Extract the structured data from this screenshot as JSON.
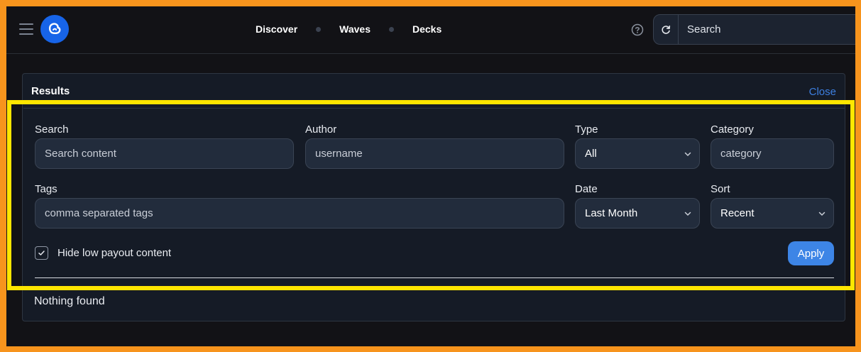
{
  "header": {
    "nav": [
      "Discover",
      "Waves",
      "Decks"
    ],
    "search_placeholder": "Search"
  },
  "icons": {
    "menu": "hamburger-menu-icon",
    "logo": "ecency-logo-icon",
    "help": "help-circle-icon",
    "refresh": "refresh-icon",
    "chevron": "chevron-down-icon",
    "check": "check-icon"
  },
  "colors": {
    "accent": "#3d85e6",
    "logo": "#1764e8",
    "highlight": "#ffe600",
    "frame": "#f7941d"
  },
  "panel": {
    "title": "Results",
    "close_label": "Close",
    "filters": {
      "search": {
        "label": "Search",
        "placeholder": "Search content"
      },
      "author": {
        "label": "Author",
        "placeholder": "username"
      },
      "type": {
        "label": "Type",
        "value": "All"
      },
      "category": {
        "label": "Category",
        "placeholder": "category"
      },
      "tags": {
        "label": "Tags",
        "placeholder": "comma separated tags"
      },
      "date": {
        "label": "Date",
        "value": "Last Month"
      },
      "sort": {
        "label": "Sort",
        "value": "Recent"
      },
      "hide_low_payout": {
        "label": "Hide low payout content",
        "checked": true
      },
      "apply_label": "Apply"
    },
    "empty_message": "Nothing found"
  }
}
